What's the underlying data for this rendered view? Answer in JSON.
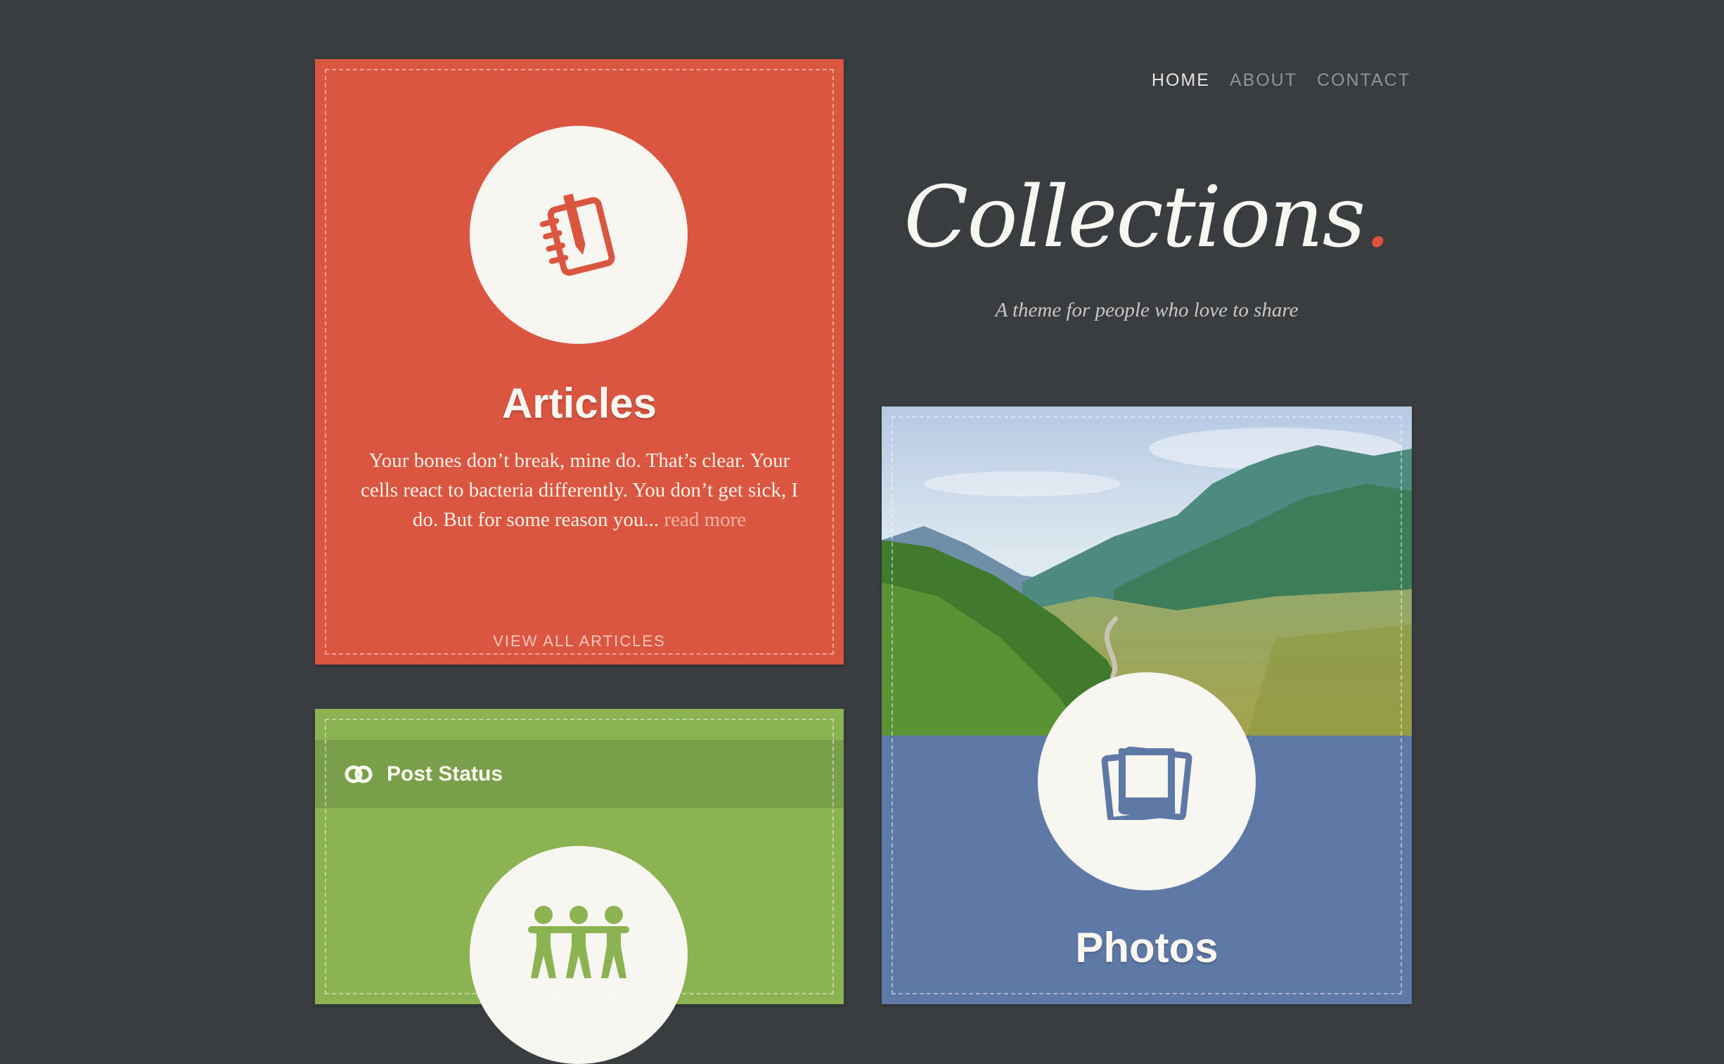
{
  "nav": {
    "items": [
      "HOME",
      "ABOUT",
      "CONTACT"
    ]
  },
  "header": {
    "brand": "Collections",
    "brand_dot": ".",
    "tagline": "A theme for people who love to share"
  },
  "articles_card": {
    "title": "Articles",
    "excerpt": "Your bones don’t break, mine do. That’s clear. Your cells react to bacteria differently. You don’t get sick, I do. But for some reason you...",
    "read_more": "read more",
    "view_all": "VIEW ALL ARTICLES",
    "color": "#db5641",
    "icon": "notebook-pen-icon"
  },
  "status_card": {
    "label": "Post Status",
    "color": "#8bb352",
    "icon": "linked-rings-icon",
    "circle_icon": "paper-people-icon"
  },
  "photos_card": {
    "title": "Photos",
    "color": "#5f79a7",
    "icon": "photo-stack-icon"
  }
}
